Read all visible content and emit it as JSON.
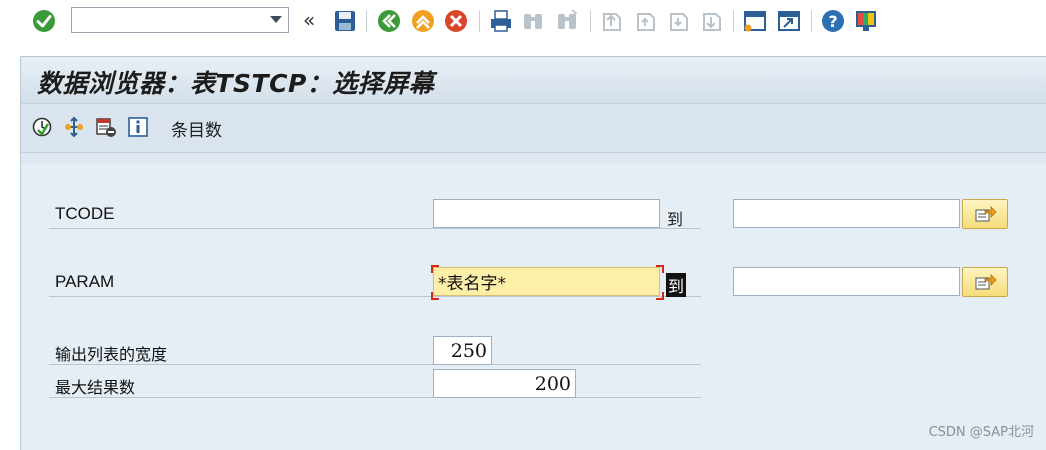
{
  "toolbar": {
    "command_field": {
      "value": "",
      "placeholder": ""
    },
    "icons": [
      "enter-icon",
      "back-icon",
      "save-icon",
      "exit-icon",
      "cancel-icon",
      "print-icon",
      "find-icon",
      "find-next-icon",
      "first-page-icon",
      "prev-page-icon",
      "next-page-icon",
      "last-page-icon",
      "new-session-icon",
      "shortcut-icon",
      "help-icon",
      "customize-layout-icon"
    ]
  },
  "screen": {
    "title": "数据浏览器：表TSTCP：选择屏幕"
  },
  "app_toolbar": {
    "entries_label": "条目数"
  },
  "selection": {
    "rows": [
      {
        "label": "TCODE",
        "from": "",
        "to_label": "到",
        "to": ""
      },
      {
        "label": "PARAM",
        "from": "*表名字*",
        "to_label": "到",
        "to": ""
      }
    ],
    "output_width": {
      "label": "输出列表的宽度",
      "value": "250"
    },
    "max_hits": {
      "label": "最大结果数",
      "value": "200"
    }
  },
  "watermark": "CSDN @SAP北河",
  "colors": {
    "background": "#e6eef5",
    "focus_field": "#fdeea8",
    "focus_corners": "#d42a1e",
    "multi_button": "#f5dd7a"
  }
}
